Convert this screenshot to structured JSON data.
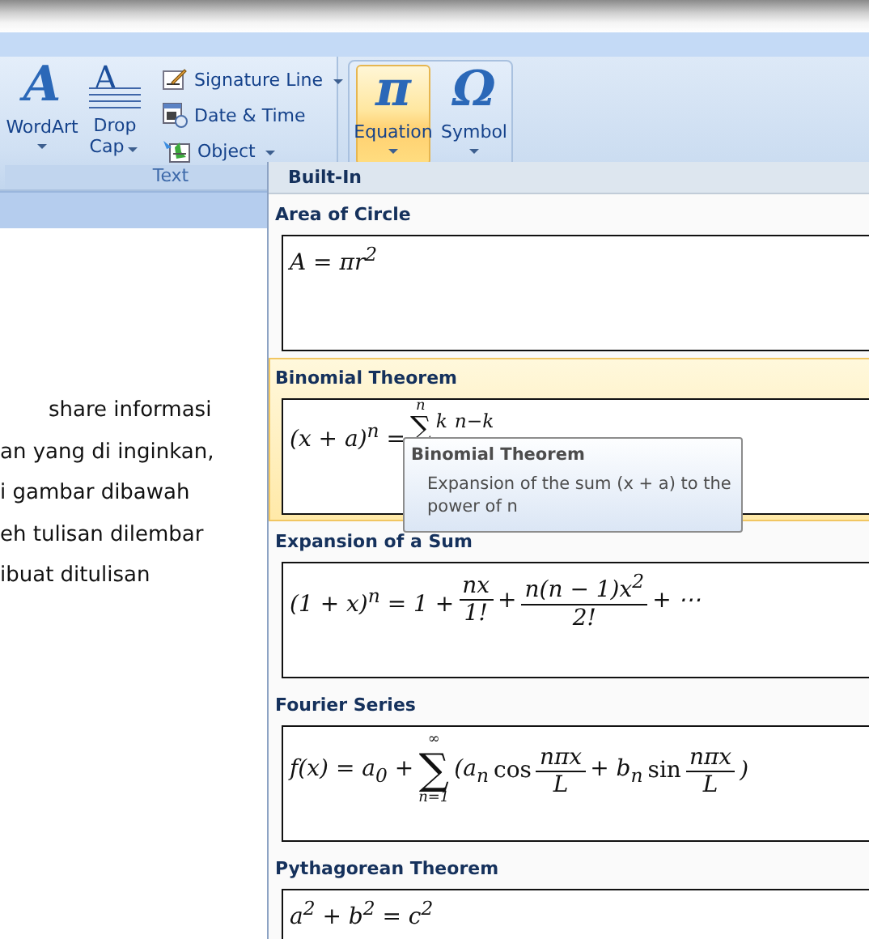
{
  "ribbon": {
    "groups": [
      {
        "label": "Text",
        "items": [
          {
            "kind": "large",
            "glyph": "A",
            "label": "WordArt",
            "has_menu": true,
            "selected": false
          },
          {
            "kind": "dropcap",
            "glyph": "A",
            "label": "Drop Cap",
            "has_menu": true,
            "selected": false
          },
          {
            "kind": "stack",
            "buttons": [
              {
                "label": "Signature Line",
                "has_menu": true
              },
              {
                "label": "Date & Time",
                "has_menu": false
              },
              {
                "label": "Object",
                "has_menu": true
              }
            ]
          }
        ]
      },
      {
        "items": [
          {
            "kind": "large",
            "glyph": "π",
            "label": "Equation",
            "has_menu": true,
            "selected": true
          },
          {
            "kind": "large",
            "glyph": "Ω",
            "label": "Symbol",
            "has_menu": true,
            "selected": false
          }
        ]
      }
    ]
  },
  "document": {
    "lines": [
      "share informasi",
      "an yang di inginkan,",
      "i gambar dibawah",
      "eh tulisan dilembar",
      "ibuat ditulisan"
    ]
  },
  "gallery": {
    "header": "Built-In",
    "items": [
      {
        "name": "Area of Circle",
        "hovered": false,
        "equation": [
          {
            "kind": "text",
            "text": "A = πr$^{2}$"
          }
        ]
      },
      {
        "name": "Binomial Theorem",
        "hovered": true,
        "equation": [
          {
            "kind": "text",
            "text": "(x + a)$^{n}$ ="
          },
          {
            "kind": "sum",
            "upper": "n",
            "symbol": "∑"
          },
          {
            "kind": "sup",
            "text": "$^{k}$ $^{n−k}$"
          }
        ]
      },
      {
        "name": "Expansion of a Sum",
        "hovered": false,
        "equation": [
          {
            "kind": "text",
            "text": "(1 + x)$^{n}$ = 1 +"
          },
          {
            "kind": "frac",
            "num": "nx",
            "den": "1!"
          },
          {
            "kind": "text",
            "text": "+"
          },
          {
            "kind": "frac",
            "num": "n(n − 1)x$^{2}$",
            "den": "2!"
          },
          {
            "kind": "text",
            "text": "+ ⋯"
          }
        ]
      },
      {
        "name": "Fourier Series",
        "hovered": false,
        "equation": [
          {
            "kind": "text",
            "text": "f(x) = a$_{0}$ +"
          },
          {
            "kind": "sum",
            "upper": "∞",
            "symbol": "∑",
            "lower": "n=1"
          },
          {
            "kind": "text",
            "text": "(a$_{n}$"
          },
          {
            "kind": "func",
            "text": "cos"
          },
          {
            "kind": "frac",
            "num": "nπx",
            "den": "L"
          },
          {
            "kind": "text",
            "text": "+ b$_{n}$"
          },
          {
            "kind": "func",
            "text": "sin"
          },
          {
            "kind": "frac",
            "num": "nπx",
            "den": "L"
          },
          {
            "kind": "text",
            "text": ")"
          }
        ]
      },
      {
        "name": "Pythagorean Theorem",
        "hovered": false,
        "equation": [
          {
            "kind": "text",
            "text": "a$^{2}$ + b$^{2}$ = c$^{2}$"
          }
        ]
      }
    ]
  },
  "tooltip": {
    "title": "Binomial Theorem",
    "text": "Expansion of the sum (x + a) to the power of n"
  }
}
